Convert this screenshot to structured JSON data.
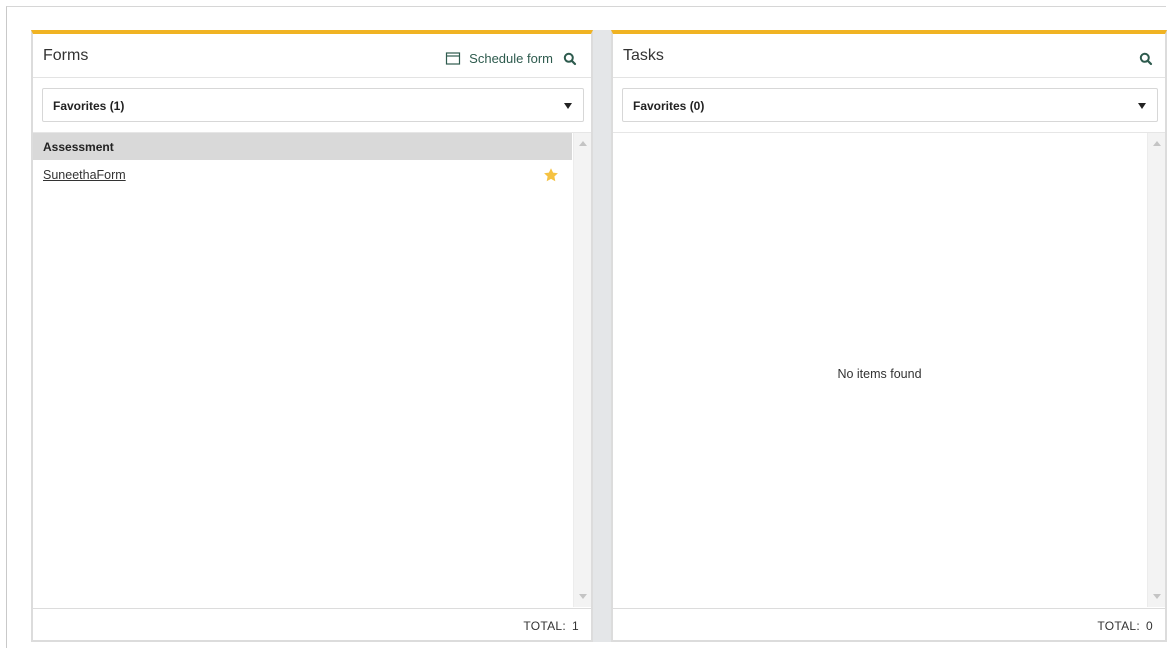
{
  "forms_panel": {
    "title": "Forms",
    "schedule_label": "Schedule form",
    "schedule_icon": "calendar-icon",
    "search_icon": "search-icon",
    "filter_selected": "Favorites (1)",
    "groups": [
      {
        "header": "Assessment",
        "items": [
          {
            "label": "SuneethaForm",
            "favorite": true,
            "favorite_icon": "star-icon"
          }
        ]
      }
    ],
    "total_label": "TOTAL:",
    "total_count": "1"
  },
  "tasks_panel": {
    "title": "Tasks",
    "search_icon": "search-icon",
    "filter_selected": "Favorites (0)",
    "empty_message": "No items found",
    "total_label": "TOTAL:",
    "total_count": "0"
  },
  "colors": {
    "accent_top_border": "#f0b323",
    "icon_green": "#2e5b4e",
    "star_gold": "#f5c242",
    "group_header_bg": "#d9d9d9"
  }
}
